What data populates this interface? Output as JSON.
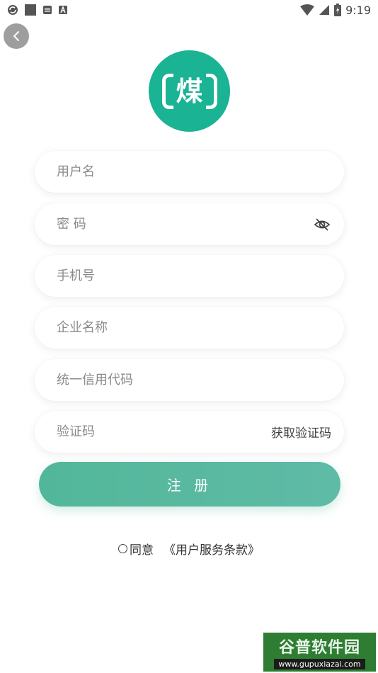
{
  "status_bar": {
    "time": "9:19",
    "left_icons": [
      "sync-icon",
      "square-app-icon",
      "message-icon",
      "font-app-icon"
    ],
    "right_icons": [
      "wifi-icon",
      "cellular-signal-icon",
      "battery-charging-icon"
    ]
  },
  "header": {
    "back_icon": "chevron-left-icon"
  },
  "logo": {
    "text": "煤",
    "color": "#1ab394"
  },
  "form": {
    "username_placeholder": "用户名",
    "password_placeholder": "密 码",
    "password_toggle_icon": "eye-off-icon",
    "phone_placeholder": "手机号",
    "company_placeholder": "企业名称",
    "credit_code_placeholder": "统一信用代码",
    "verify_code_placeholder": "验证码",
    "get_code_label": "获取验证码"
  },
  "register": {
    "label": "注 册",
    "color": "#52b79a"
  },
  "agreement": {
    "agree_text": "同意",
    "link_text": "《用户服务条款》"
  },
  "watermark": {
    "title": "谷普软件园",
    "url": "www.gupuxiazai.com"
  }
}
